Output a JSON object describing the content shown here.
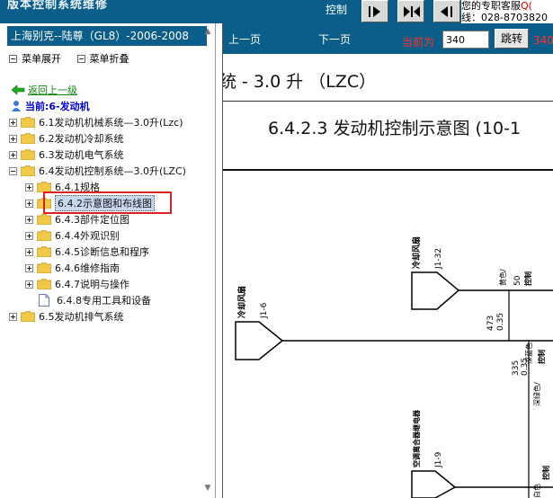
{
  "window": {
    "top_left_text": "版本控制系统维修",
    "control_label": "控制",
    "service_line1": "您的专职客服",
    "service_line1_suffix": "Q(",
    "service_line2": "线：028-8703820"
  },
  "sidebar": {
    "title": "上海别克--陆尊（GL8）-2006-2008",
    "menu_expand": "菜单展开",
    "menu_collapse": "菜单折叠",
    "back_link": "返回上一级",
    "current_label": "当前:6-发动机",
    "tree": [
      {
        "label": "6.1发动机机械系统—3.0升(Lzc)"
      },
      {
        "label": "6.2发动机冷却系统"
      },
      {
        "label": "6.3发动机电气系统"
      },
      {
        "label": "6.4发动机控制系统—3.0升(LZC)"
      },
      {
        "label": "6.4.1规格"
      },
      {
        "label": "6.4.2示意图和布线图"
      },
      {
        "label": "6.4.3部件定位图"
      },
      {
        "label": "6.4.4外观识别"
      },
      {
        "label": "6.4.5诊断信息和程序"
      },
      {
        "label": "6.4.6维修指南"
      },
      {
        "label": "6.4.7说明与操作"
      },
      {
        "label": "6.4.8专用工具和设备"
      },
      {
        "label": "6.5发动机排气系统"
      }
    ]
  },
  "navbar": {
    "prev_label": "上一页",
    "next_label": "下一页",
    "current_page_label": "当前为",
    "page_value": "340",
    "go_label": "跳转",
    "total_pages": "340"
  },
  "document": {
    "header_fragment": "统 - 3.0 升 （LZC）",
    "subtitle": "6.4.2.3 发动机控制示意图 (10-1",
    "diagram": {
      "conn1_label": "冷却风扇",
      "conn1_pin": "J1-6",
      "conn2_label": "冷却风扇",
      "conn2_pin": "J1-32",
      "conn3_label": "空调离合器继电器",
      "conn3_pin": "J1-9",
      "wire1_num": "473",
      "wire1_size": "0.35",
      "wire1_color": "深蓝色",
      "wire2_num": "50",
      "wire2_color": "黄色/",
      "wire2_label": "控制",
      "wire3_num": "335",
      "wire3_size": "0.35",
      "wire3_color": "深绿色/",
      "wire3_label": "控制",
      "wire4_color": "白色",
      "wire4_label": "控制"
    }
  },
  "colors": {
    "title_blue": "#0b5d8a",
    "highlight_red": "#e02020",
    "link_green": "#118811",
    "current_blue": "#0000cc"
  }
}
